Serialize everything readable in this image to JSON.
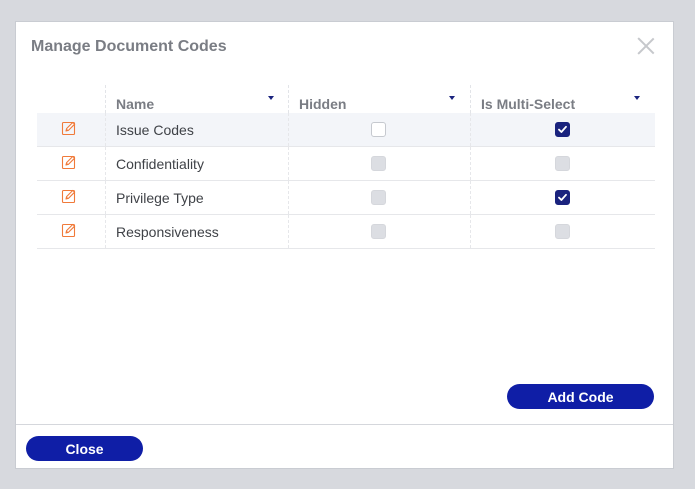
{
  "dialog": {
    "title": "Manage Document Codes",
    "close_icon": "close-x-icon"
  },
  "table": {
    "columns": [
      {
        "label": "",
        "sortable": false
      },
      {
        "label": "Name",
        "sortable": true
      },
      {
        "label": "Hidden",
        "sortable": true
      },
      {
        "label": "Is Multi-Select",
        "sortable": true
      }
    ],
    "rows": [
      {
        "name": "Issue Codes",
        "hidden": false,
        "hidden_enabled": true,
        "multi_select": true,
        "multi_select_enabled": true,
        "selected": true
      },
      {
        "name": "Confidentiality",
        "hidden": false,
        "hidden_enabled": false,
        "multi_select": false,
        "multi_select_enabled": false,
        "selected": false
      },
      {
        "name": "Privilege Type",
        "hidden": false,
        "hidden_enabled": false,
        "multi_select": true,
        "multi_select_enabled": true,
        "selected": false
      },
      {
        "name": "Responsiveness",
        "hidden": false,
        "hidden_enabled": false,
        "multi_select": false,
        "multi_select_enabled": false,
        "selected": false
      }
    ]
  },
  "buttons": {
    "add_code": "Add Code",
    "close": "Close"
  },
  "colors": {
    "accent": "#0f1ea6",
    "checkbox_checked": "#1a237e",
    "edit_icon": "#f07a3a"
  }
}
